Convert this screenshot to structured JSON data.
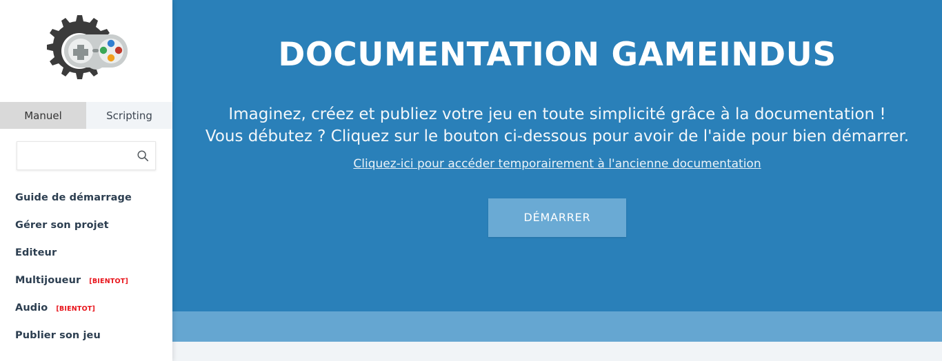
{
  "sidebar": {
    "logo": {
      "icon_name": "gear-gamepad-logo",
      "gear_color": "#3b3b3b",
      "gamepad_body_color": "#c9cdcd",
      "gamepad_disc_color": "#eceeee",
      "dpad_color": "#8a9191",
      "button_colors": [
        "#2f7fd0",
        "#3aa757",
        "#c0392b",
        "#f0a01e"
      ]
    },
    "tabs": [
      {
        "label": "Manuel",
        "active": true
      },
      {
        "label": "Scripting",
        "active": false
      }
    ],
    "search": {
      "value": "",
      "placeholder": "",
      "icon_name": "search-icon"
    },
    "menu_items": [
      {
        "label": "Guide de démarrage",
        "badge": ""
      },
      {
        "label": "Gérer son projet",
        "badge": ""
      },
      {
        "label": "Editeur",
        "badge": ""
      },
      {
        "label": "Multijoueur",
        "badge": "[BIENTOT]"
      },
      {
        "label": "Audio",
        "badge": "[BIENTOT]"
      },
      {
        "label": "Publier son jeu",
        "badge": ""
      }
    ],
    "badge_color": "#e8131a"
  },
  "hero": {
    "title": "DOCUMENTATION GAMEINDUS",
    "subtitle_line1": "Imaginez, créez et publiez votre jeu en toute simplicité grâce à la documentation !",
    "subtitle_line2": "Vous débutez ? Cliquez sur le bouton ci-dessous pour avoir de l'aide pour bien démarrer.",
    "link_text": "Cliquez-ici pour accéder temporairement à l'ancienne documentation",
    "button_label": "DÉMARRER",
    "background_color": "#2a80b9",
    "button_color": "#6aaad4",
    "band_color": "#65a6d1"
  }
}
